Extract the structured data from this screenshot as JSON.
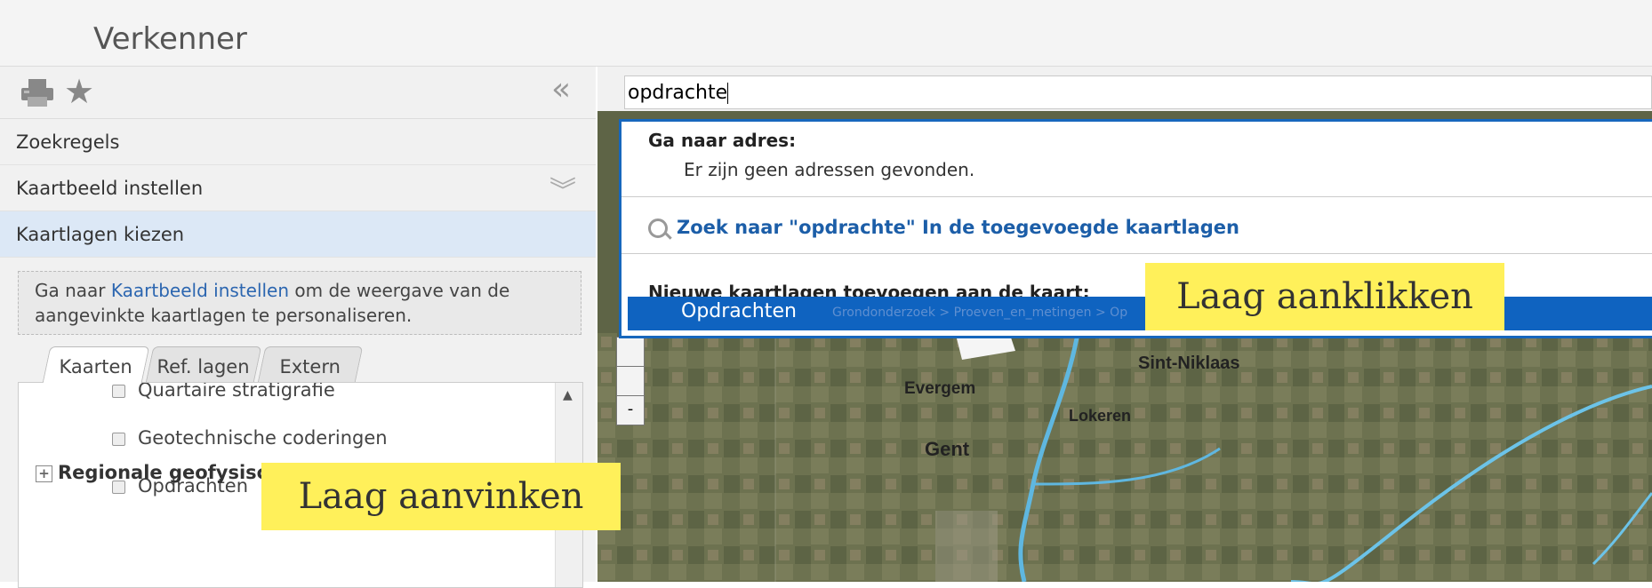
{
  "app": {
    "title": "Verkenner"
  },
  "sidebar": {
    "sections": [
      {
        "label": "Zoekregels"
      },
      {
        "label": "Kaartbeeld instellen"
      },
      {
        "label": "Kaartlagen kiezen"
      }
    ],
    "notice": {
      "prefix": "Ga naar ",
      "link": "Kaartbeeld instellen",
      "suffix": " om de weergave van de aangevinkte kaartlagen te personaliseren."
    },
    "tabs": [
      "Kaarten",
      "Ref. lagen",
      "Extern"
    ],
    "layers": [
      {
        "label": "Quartaire stratigrafie",
        "checked": false
      },
      {
        "label": "Geotechnische coderingen",
        "checked": false
      },
      {
        "label": "Opdrachten",
        "checked": false
      }
    ],
    "group": "Regionale geofysische data"
  },
  "search": {
    "value": "opdrachte"
  },
  "dropdown": {
    "address_heading": "Ga naar adres:",
    "address_result": "Er zijn geen adressen gevonden.",
    "search_layers": "Zoek naar \"opdrachte\" In de toegevoegde kaartlagen",
    "new_layers_heading": "Nieuwe kaartlagen toevoegen aan de kaart:",
    "highlight_main": "Opdrachten",
    "highlight_path": "Grondonderzoek > Proeven_en_metingen > Op"
  },
  "callouts": {
    "click": "Laag aanklikken",
    "check": "Laag aanvinken"
  },
  "map": {
    "cities": [
      "Sint-Niklaas",
      "Evergem",
      "Lokeren",
      "Gent"
    ]
  },
  "colors": {
    "accent": "#1767bd",
    "highlight": "#fff05a"
  }
}
